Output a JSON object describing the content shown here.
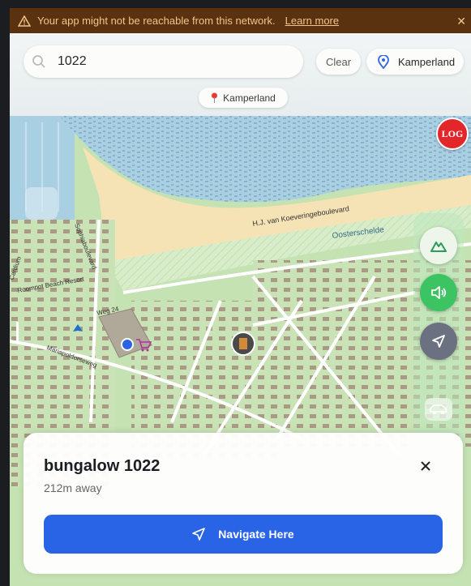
{
  "banner": {
    "message": "Your app might not be reachable from this network.",
    "link": "Learn more",
    "icon": "warning-triangle-icon",
    "close_icon": "close-icon",
    "background": "#5a3210",
    "text_color": "#f3c58a"
  },
  "search": {
    "value": "1022",
    "icon": "search-icon"
  },
  "clear_label": "Clear",
  "location": {
    "label": "Kamperland",
    "icon": "location-pin-icon"
  },
  "chip": {
    "label": "Kamperland",
    "icon": "red-pin-icon"
  },
  "log_button": {
    "label": "LOG",
    "color": "#e2262a"
  },
  "map": {
    "labels": {
      "road1": "H.J. van Koeveringeboulevard",
      "water": "Oosterschelde",
      "street1": "Sophiaboulevard",
      "place1": "Roompot Beach Resort",
      "street2": "Cardium",
      "street3": "Weg 24",
      "street4": "Mariapolderseweg"
    },
    "markers": [
      "current-location-dot",
      "shopping-cart-icon",
      "camping-tent-icon",
      "destination-marker-icon"
    ]
  },
  "controls": {
    "terrain": "mountain-icon",
    "sound": "speaker-icon",
    "navigation": "navigation-arrow-icon",
    "transport": "car-icon"
  },
  "destination": {
    "title": "bungalow 1022",
    "distance": "212m away",
    "close_icon": "close-icon",
    "navigate_label": "Navigate Here",
    "navigate_color": "#2a64e6"
  }
}
